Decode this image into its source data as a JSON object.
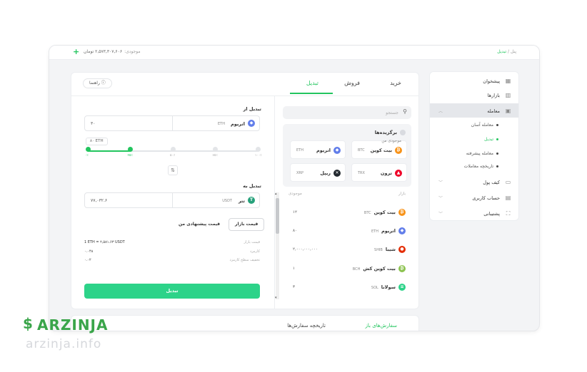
{
  "topbar": {
    "plus": "+",
    "balance_label": "موجودی:",
    "balance_value": "۲,۵۷۳,۳۰۷,۶۰۶ تومان",
    "crumb_root": "پنل",
    "crumb_sep": " / ",
    "crumb_current": "تبدیل"
  },
  "sidebar": {
    "items": [
      {
        "label": "پیشخوان",
        "icon": "dashboard-icon"
      },
      {
        "label": "بازارها",
        "icon": "chart-icon"
      },
      {
        "label": "معامله",
        "icon": "wallet-icon"
      },
      {
        "label": "کیف پول",
        "icon": "wallet-icon"
      },
      {
        "label": "حساب کاربری",
        "icon": "card-icon"
      },
      {
        "label": "پشتیبانی",
        "icon": "support-icon"
      }
    ],
    "sub_items": [
      {
        "label": "معامله آسان"
      },
      {
        "label": "تبدیل"
      },
      {
        "label": "معامله پیشرفته"
      },
      {
        "label": "تاریخچه معاملات"
      }
    ]
  },
  "tabs": [
    {
      "label": "خرید"
    },
    {
      "label": "فروش"
    },
    {
      "label": "تبدیل"
    }
  ],
  "help": {
    "label": "راهنما",
    "icon": "help-icon"
  },
  "search": {
    "placeholder": "جستجو",
    "icon": "search-icon"
  },
  "favorites": {
    "title": "برگزیده‌ها",
    "cards": [
      {
        "name": "بیت کوین",
        "symbol": "BTC",
        "color": "#f7931a",
        "glyph": "₿"
      },
      {
        "name": "اتریوم",
        "symbol": "ETH",
        "color": "#627eea",
        "glyph": "◆"
      },
      {
        "name": "ترون",
        "symbol": "TRX",
        "color": "#ef0027",
        "glyph": "▲"
      },
      {
        "name": "ریپل",
        "symbol": "XRP",
        "color": "#23292f",
        "glyph": "✕"
      }
    ]
  },
  "market_list": {
    "col_market": "بازار",
    "col_balance": "موجودی",
    "rows": [
      {
        "name": "بیت کوین",
        "symbol": "BTC",
        "amount": "۱۲",
        "color": "#f7931a",
        "glyph": "₿"
      },
      {
        "name": "اتریوم",
        "symbol": "ETH",
        "amount": "۸۰",
        "color": "#627eea",
        "glyph": "◆"
      },
      {
        "name": "شیبا",
        "symbol": "SHIB",
        "amount": "۲,۰۰۰,۰۰۰,۰۰۰",
        "color": "#e42d04",
        "glyph": "●"
      },
      {
        "name": "بیت کوین کش",
        "symbol": "BCH",
        "amount": "۱",
        "color": "#8dc351",
        "glyph": "₿"
      },
      {
        "name": "سولانا",
        "symbol": "SOL",
        "amount": "۳",
        "color": "#2dd389",
        "glyph": "≡"
      }
    ]
  },
  "convert": {
    "from_label": "تبدیل از",
    "from_amount": "۳۰",
    "from_name": "اتریوم",
    "from_symbol": "ETH",
    "balance_label": "موجودی من",
    "balance_value": "۸۰ ETH",
    "slider_fraction": 0.25,
    "ticks": [
      "۰٪",
      "۲۵٪",
      "۵۰٪",
      "۷۵٪",
      "۱۰۰٪"
    ],
    "swap_icon": "⇅",
    "to_label": "تبدیل به",
    "to_amount": "۷۷,۰۳۲.۶",
    "to_name": "تتر",
    "to_symbol": "USDT",
    "market_price_btn": "قیمت بازار",
    "suggested_price": "قیمت پیشنهادی من",
    "info": [
      {
        "key": "قیمت بازار",
        "value": "1 ETH = ۲,۵۸۱.۶۳ USDT"
      },
      {
        "key": "کارمزد",
        "value": "۰.۰۴۸"
      },
      {
        "key": "تخفیف سطح کارمزد",
        "value": "۰.۰۲"
      }
    ],
    "submit": "تبدیل"
  },
  "orders": {
    "open": "سفارش‌های باز",
    "history": "تاریخچه سفارش‌ها"
  },
  "watermark": {
    "brand": "ARZINJA",
    "url": "arzinja.info"
  }
}
